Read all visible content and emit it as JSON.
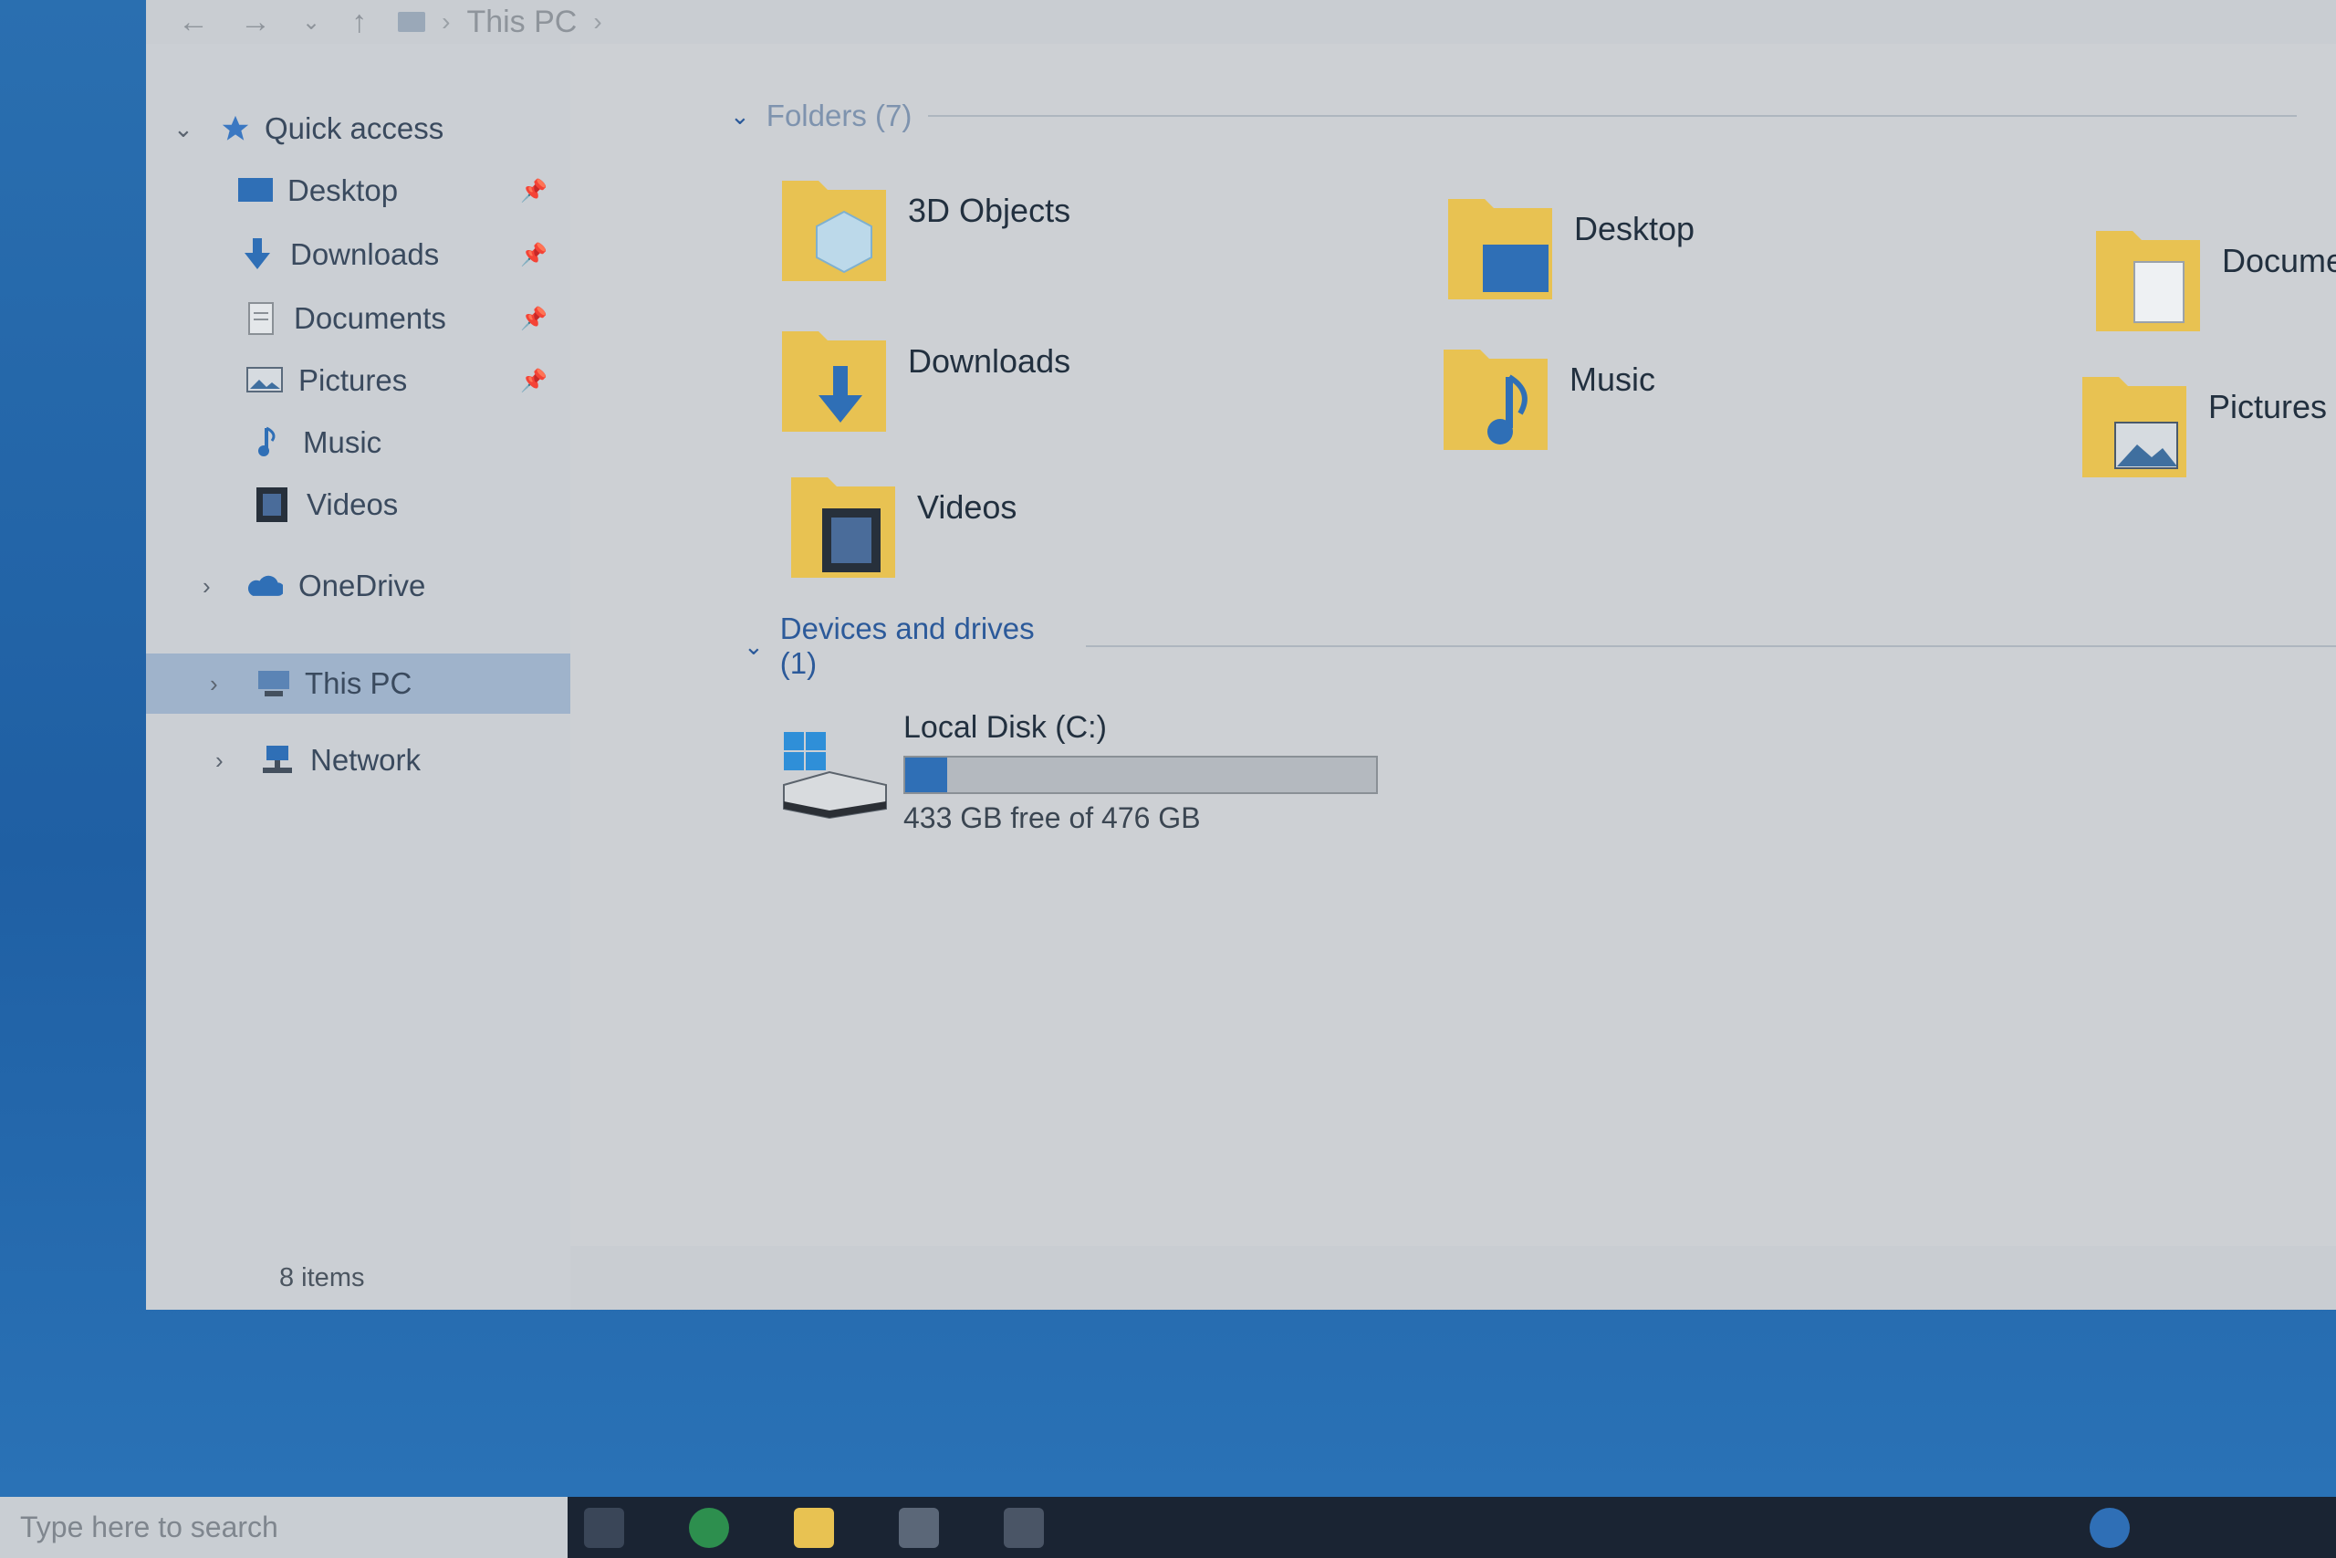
{
  "address": {
    "location": "This PC"
  },
  "nav": {
    "quick_access": "Quick access",
    "items": [
      {
        "label": "Desktop",
        "icon": "desktop-icon",
        "pinned": true
      },
      {
        "label": "Downloads",
        "icon": "downloads-icon",
        "pinned": true
      },
      {
        "label": "Documents",
        "icon": "documents-icon",
        "pinned": true
      },
      {
        "label": "Pictures",
        "icon": "pictures-icon",
        "pinned": true
      },
      {
        "label": "Music",
        "icon": "music-icon",
        "pinned": false
      },
      {
        "label": "Videos",
        "icon": "videos-icon",
        "pinned": false
      }
    ],
    "onedrive": "OneDrive",
    "this_pc": "This PC",
    "network": "Network"
  },
  "content": {
    "folders_header": "Folders (7)",
    "folders": [
      {
        "label": "3D Objects",
        "icon": "3d-objects-folder-icon"
      },
      {
        "label": "Desktop",
        "icon": "desktop-folder-icon"
      },
      {
        "label": "Documents",
        "icon": "documents-folder-icon"
      },
      {
        "label": "Downloads",
        "icon": "downloads-folder-icon"
      },
      {
        "label": "Music",
        "icon": "music-folder-icon"
      },
      {
        "label": "Pictures",
        "icon": "pictures-folder-icon"
      },
      {
        "label": "Videos",
        "icon": "videos-folder-icon"
      }
    ],
    "devices_header": "Devices and drives (1)",
    "drive": {
      "name": "Local Disk (C:)",
      "free_text": "433 GB free of 476 GB",
      "used_fraction": 0.09
    }
  },
  "status": {
    "items": "8 items"
  },
  "taskbar": {
    "search_placeholder": "Type here to search"
  },
  "colors": {
    "accent": "#2f6fb6",
    "folder": "#e8c252",
    "selection": "#9fb3cb"
  }
}
